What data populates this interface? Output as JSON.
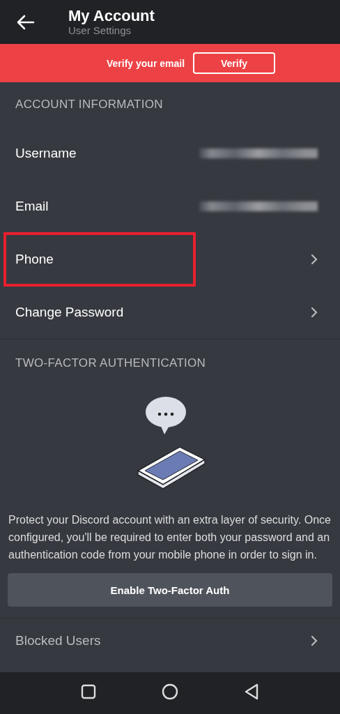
{
  "header": {
    "title": "My Account",
    "subtitle": "User Settings"
  },
  "banner": {
    "message": "Verify your email",
    "button": "Verify"
  },
  "account_section": {
    "heading": "ACCOUNT INFORMATION",
    "rows": [
      {
        "kind": "value",
        "label": "Username",
        "highlighted": false
      },
      {
        "kind": "value",
        "label": "Email",
        "highlighted": false
      },
      {
        "kind": "link",
        "label": "Phone",
        "highlighted": true
      },
      {
        "kind": "link",
        "label": "Change Password",
        "highlighted": false
      }
    ]
  },
  "two_factor": {
    "heading": "TWO-FACTOR AUTHENTICATION",
    "description": "Protect your Discord account with an extra layer of security. Once configured, you'll be required to enter both your password and an authentication code from your mobile phone in order to sign in.",
    "button": "Enable Two-Factor Auth"
  },
  "more_rows": [
    {
      "kind": "link",
      "label": "Blocked Users",
      "highlighted": false
    }
  ]
}
